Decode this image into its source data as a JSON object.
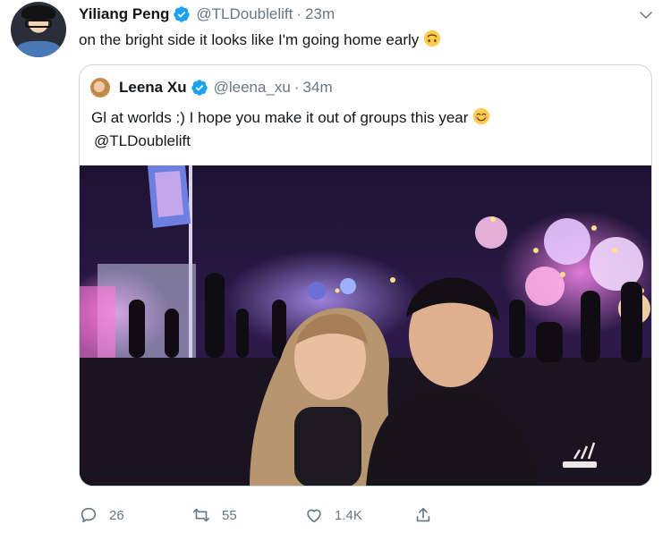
{
  "tweet": {
    "author_name": "Yiliang Peng",
    "author_handle": "@TLDoublelift",
    "separator": "·",
    "time": "23m",
    "text": "on the bright side it looks like I'm going home early",
    "emoji": "upside-down-face-emoji",
    "verified_icon": "verified-badge-icon",
    "caret_icon": "chevron-down-icon"
  },
  "quoted": {
    "author_name": "Leena Xu",
    "author_handle": "@leena_xu",
    "separator": "·",
    "time": "34m",
    "text_line1": "Gl at worlds :) I hope you make it out of groups this year",
    "text_line2": "@TLDoublelift",
    "emoji": "smiling-face-emoji"
  },
  "actions": {
    "reply_count": "26",
    "retweet_count": "55",
    "like_count": "1.4K",
    "reply_icon": "reply-icon",
    "retweet_icon": "retweet-icon",
    "like_icon": "heart-icon",
    "share_icon": "share-icon"
  },
  "colors": {
    "text": "#14171a",
    "secondary": "#657786",
    "verified": "#1da1f2",
    "border": "#ccd6dd"
  }
}
